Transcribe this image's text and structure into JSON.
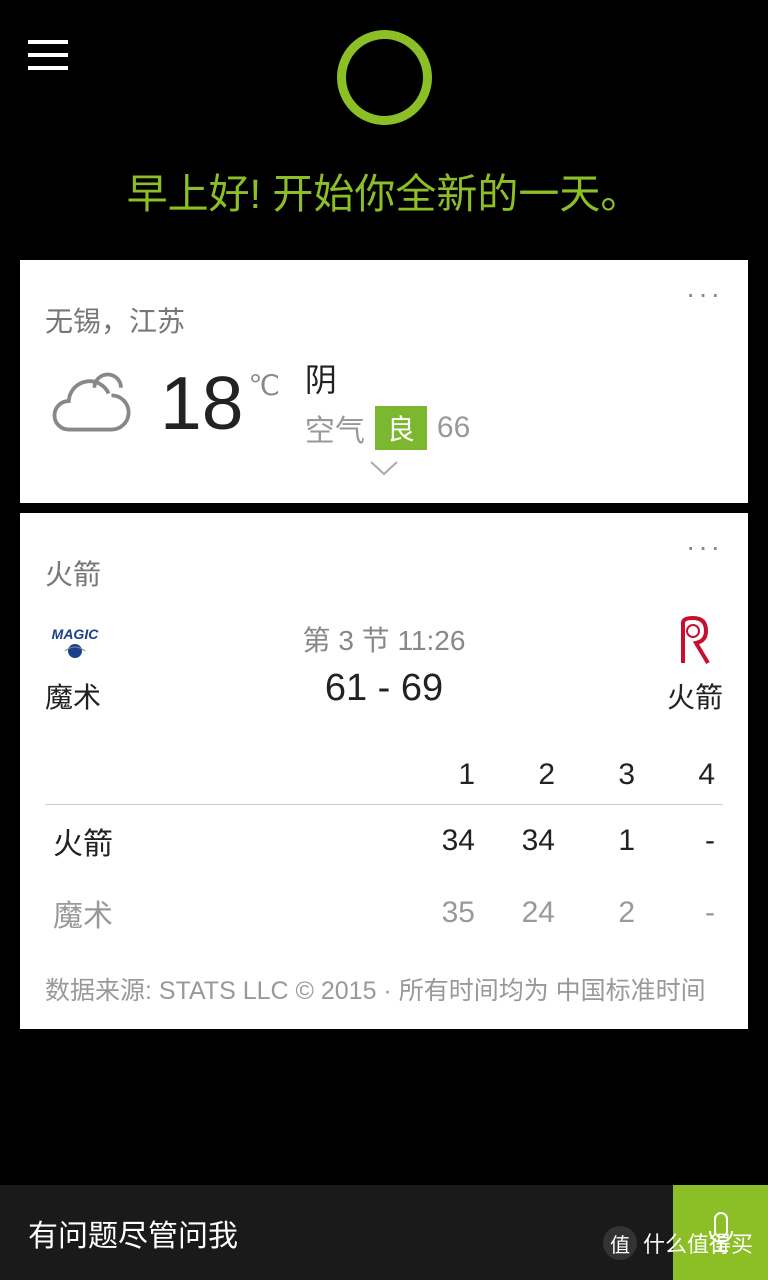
{
  "greeting": "早上好! 开始你全新的一天。",
  "weather": {
    "location": "无锡，江苏",
    "temp": "18",
    "unit": "℃",
    "condition": "阴",
    "air_label": "空气",
    "air_quality": "良",
    "air_value": "66"
  },
  "sports": {
    "card_title": "火箭",
    "team_away": "魔术",
    "team_home": "火箭",
    "status": "第 3 节 11:26",
    "score": "61 - 69",
    "quarters": [
      "1",
      "2",
      "3",
      "4"
    ],
    "rows": [
      {
        "name": "火箭",
        "q": [
          "34",
          "34",
          "1",
          "-"
        ]
      },
      {
        "name": "魔术",
        "q": [
          "35",
          "24",
          "2",
          "-"
        ]
      }
    ],
    "source": "数据来源: STATS LLC © 2015 · 所有时间均为 中国标准时间"
  },
  "bottom": {
    "prompt": "有问题尽管问我"
  },
  "watermark": {
    "icon": "值",
    "text": "什么值得买"
  }
}
